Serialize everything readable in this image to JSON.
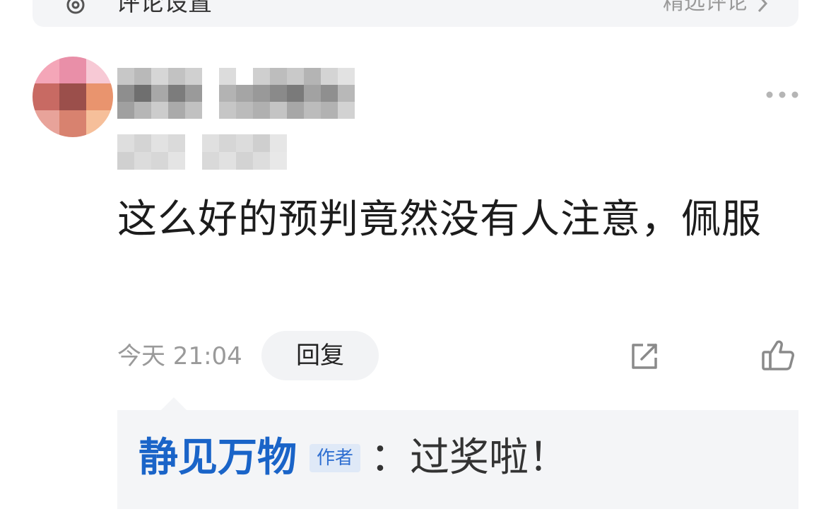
{
  "top_bar": {
    "label": "评论设置",
    "right_text": "精选评论",
    "gear_icon": "gear-icon",
    "chevron_icon": "chevron-right-icon"
  },
  "comment": {
    "avatar_icon": "avatar",
    "more_icon": "more-icon",
    "text": "这么好的预判竟然没有人注意，佩服",
    "time": "今天 21:04",
    "reply_label": "回复",
    "share_icon": "share-icon",
    "like_icon": "thumbs-up-icon"
  },
  "reply": {
    "author": "静见万物",
    "badge": "作者",
    "text": "：过奖啦！"
  },
  "colors": {
    "author_blue": "#1a64c8",
    "badge_bg": "#dfe9f7",
    "panel_bg": "#f4f5f7",
    "muted": "#9a9a9a"
  }
}
